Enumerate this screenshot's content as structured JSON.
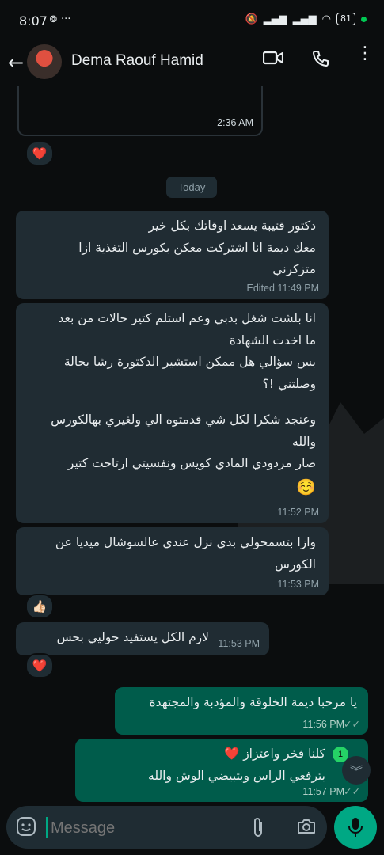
{
  "status": {
    "time": "8:07",
    "battery": "81"
  },
  "header": {
    "contact_name": "Dema Raouf Hamid"
  },
  "messages": [
    {
      "dir": "out",
      "time": "2:36 AM",
      "reaction": "❤️"
    },
    {
      "dir": "in",
      "lines": [
        "دكتور قتيبة يسعد اوقاتك بكل خير",
        "معك ديمة انا اشتركت معكن بكورس التغذية ازا",
        "متزكرني"
      ],
      "time": "Edited 11:49 PM"
    },
    {
      "dir": "in",
      "lines": [
        "انا بلشت شغل بدبي وعم استلم كتير حالات من بعد",
        "ما اخدت الشهادة",
        "بس سؤالي هل ممكن استشير الدكتورة رشا بحالة",
        "وصلتني !؟",
        "",
        "وعنجد شكرا لكل شي قدمتوه الي ولغيري بهالكورس",
        "والله",
        "صار مردودي المادي كويس ونفسيتي ارتاحت كتير",
        "☺️"
      ],
      "time": "11:52 PM"
    },
    {
      "dir": "in",
      "lines": [
        "وازا بتسمحولي بدي نزل عندي عالسوشال ميديا عن",
        "الكورس"
      ],
      "time": "11:53 PM",
      "reaction": "👍🏻"
    },
    {
      "dir": "in",
      "lines": [
        "لازم الكل يستفيد حوليي بحس"
      ],
      "time": "11:53 PM",
      "reaction": "❤️"
    },
    {
      "dir": "out",
      "lines": [
        "يا مرحبا ديمة الخلوقة والمؤدبة والمجتهدة"
      ],
      "time": "11:56 PM"
    },
    {
      "dir": "out",
      "lines": [
        "كلنا فخر واعتزاز ❤️",
        "بترفعي الراس وبتبيضي الوش والله"
      ],
      "time": "11:57 PM"
    }
  ],
  "date_divider": "Today",
  "unread_count": "1",
  "composer": {
    "placeholder": "Message"
  }
}
